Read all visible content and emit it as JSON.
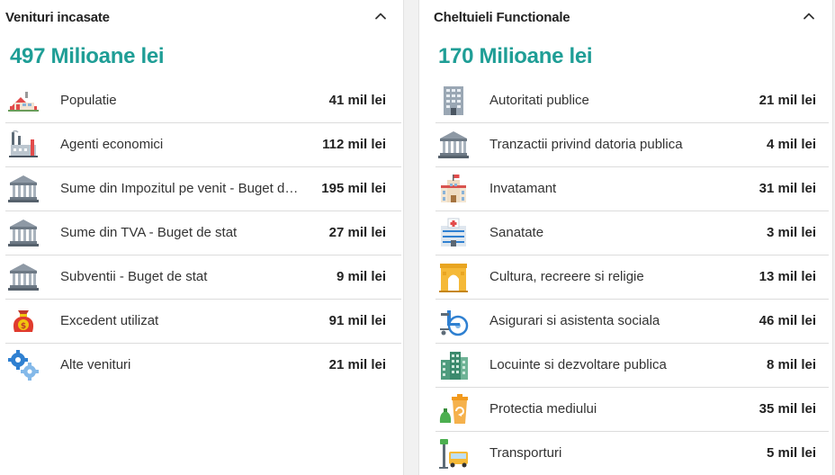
{
  "left_panel": {
    "title": "Venituri incasate",
    "total": "497 Milioane lei",
    "rows": [
      {
        "label": "Populatie",
        "value": "41 mil lei",
        "icon": "house-icon"
      },
      {
        "label": "Agenti economici",
        "value": "112 mil lei",
        "icon": "factory-icon"
      },
      {
        "label": "Sume din Impozitul pe venit - Buget de stat",
        "value": "195 mil lei",
        "icon": "bank-icon"
      },
      {
        "label": "Sume din TVA - Buget de stat",
        "value": "27 mil lei",
        "icon": "bank-icon"
      },
      {
        "label": "Subventii - Buget de stat",
        "value": "9 mil lei",
        "icon": "bank-icon"
      },
      {
        "label": "Excedent utilizat",
        "value": "91 mil lei",
        "icon": "money-bag-icon"
      },
      {
        "label": "Alte venituri",
        "value": "21 mil lei",
        "icon": "gears-icon"
      }
    ]
  },
  "right_panel": {
    "title": "Cheltuieli Functionale",
    "total": "170 Milioane lei",
    "rows": [
      {
        "label": "Autoritati publice",
        "value": "21 mil lei",
        "icon": "office-building-icon"
      },
      {
        "label": "Tranzactii privind datoria publica",
        "value": "4 mil lei",
        "icon": "bank-icon"
      },
      {
        "label": "Invatamant",
        "value": "31 mil lei",
        "icon": "school-icon"
      },
      {
        "label": "Sanatate",
        "value": "3 mil lei",
        "icon": "hospital-icon"
      },
      {
        "label": "Cultura, recreere si religie",
        "value": "13 mil lei",
        "icon": "arch-icon"
      },
      {
        "label": "Asigurari si asistenta sociala",
        "value": "46 mil lei",
        "icon": "wheelchair-icon"
      },
      {
        "label": "Locuinte si dezvoltare publica",
        "value": "8 mil lei",
        "icon": "apartment-building-icon"
      },
      {
        "label": "Protectia mediului",
        "value": "35 mil lei",
        "icon": "recycle-bin-icon"
      },
      {
        "label": "Transporturi",
        "value": "5 mil lei",
        "icon": "bus-stop-icon"
      }
    ]
  },
  "colors": {
    "accent": "#1f9e96",
    "divider": "#dcdcdc",
    "background": "#f1f1f1"
  }
}
